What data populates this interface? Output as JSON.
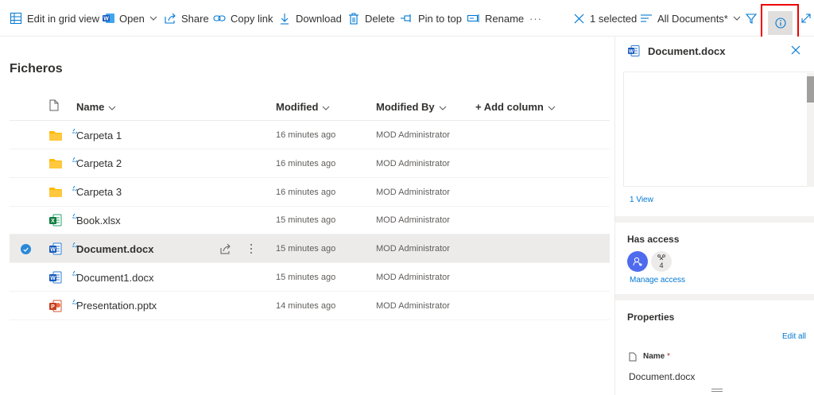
{
  "toolbar": {
    "edit_grid": "Edit in grid view",
    "open": "Open",
    "share": "Share",
    "copy_link": "Copy link",
    "download": "Download",
    "delete": "Delete",
    "pin_to_top": "Pin to top",
    "rename": "Rename",
    "more": "···",
    "selected_count": "1 selected",
    "view_name": "All Documents*",
    "colors": {
      "word_blue": "#185abd",
      "highlight_red": "#e00000"
    }
  },
  "list": {
    "title": "Ficheros",
    "columns": {
      "name": "Name",
      "modified": "Modified",
      "modified_by": "Modified By",
      "add_column": "+ Add column"
    },
    "rows": [
      {
        "name": "Carpeta 1",
        "type": "folder",
        "modified": "16 minutes ago",
        "modified_by": "MOD Administrator",
        "selected": false
      },
      {
        "name": "Carpeta 2",
        "type": "folder",
        "modified": "16 minutes ago",
        "modified_by": "MOD Administrator",
        "selected": false
      },
      {
        "name": "Carpeta 3",
        "type": "folder",
        "modified": "16 minutes ago",
        "modified_by": "MOD Administrator",
        "selected": false
      },
      {
        "name": "Book.xlsx",
        "type": "excel",
        "modified": "15 minutes ago",
        "modified_by": "MOD Administrator",
        "selected": false
      },
      {
        "name": "Document.docx",
        "type": "word",
        "modified": "15 minutes ago",
        "modified_by": "MOD Administrator",
        "selected": true
      },
      {
        "name": "Document1.docx",
        "type": "word",
        "modified": "15 minutes ago",
        "modified_by": "MOD Administrator",
        "selected": false
      },
      {
        "name": "Presentation.pptx",
        "type": "powerpoint",
        "modified": "14 minutes ago",
        "modified_by": "MOD Administrator",
        "selected": false
      }
    ]
  },
  "details": {
    "file_name": "Document.docx",
    "views": "1 View",
    "has_access": "Has access",
    "shared_count": "4",
    "manage_access": "Manage access",
    "properties": "Properties",
    "edit_all": "Edit all",
    "name_label": "Name",
    "required_mark": "*",
    "name_value": "Document.docx"
  }
}
